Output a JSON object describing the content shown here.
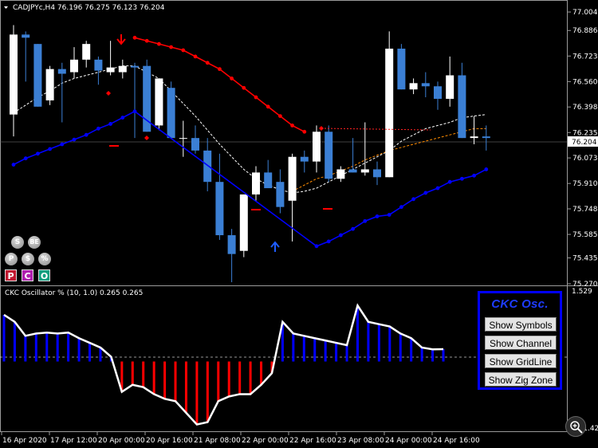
{
  "header": {
    "symbol_line": "CADJPYc,H4  76.196 76.275 76.123 76.204",
    "indicator_line": "CKC Oscillator % (10, 1.0) 0.265 0.265"
  },
  "current_price": "76.204",
  "sub_axis_top": "1.529",
  "sub_axis_bottom": "-1.427",
  "panel": {
    "title": "CKC Osc.",
    "buttons": [
      "Show Symbols",
      "Show Channel",
      "Show GridLine",
      "Show Zig Zone"
    ]
  },
  "toolbar": {
    "round_buttons": [
      "S",
      "BE",
      "P",
      "$",
      "%"
    ],
    "square_buttons": [
      "P",
      "C",
      "O"
    ]
  },
  "colors": {
    "background": "#000000",
    "bull_candle": "#ffffff",
    "bear_candle": "#3b7fd4",
    "upper_band": "#ff0000",
    "lower_band": "#0000ff",
    "mid_line": "#ffffff",
    "orange_line": "#ff8c00",
    "osc_positive": "#0000ff",
    "osc_negative": "#ff0000",
    "osc_line": "#ffffff"
  },
  "chart_data": [
    {
      "type": "candlestick",
      "title": "CADJPYc,H4",
      "y_ticks": [
        "77.004",
        "76.886",
        "76.723",
        "76.560",
        "76.398",
        "76.235",
        "76.073",
        "75.910",
        "75.748",
        "75.585",
        "75.435",
        "75.270"
      ],
      "ylim": [
        75.27,
        77.05
      ],
      "x_ticks": [
        "16 Apr 2020",
        "17 Apr 12:00",
        "20 Apr 00:00",
        "20 Apr 16:00",
        "21 Apr 08:00",
        "22 Apr 00:00",
        "22 Apr 16:00",
        "23 Apr 08:00",
        "24 Apr 00:00",
        "24 Apr 16:00"
      ],
      "candles": [
        {
          "o": 76.35,
          "h": 76.92,
          "l": 76.21,
          "c": 76.86
        },
        {
          "o": 76.86,
          "h": 76.88,
          "l": 76.56,
          "c": 76.84
        },
        {
          "o": 76.8,
          "h": 76.8,
          "l": 76.4,
          "c": 76.4
        },
        {
          "o": 76.44,
          "h": 76.66,
          "l": 76.41,
          "c": 76.64
        },
        {
          "o": 76.64,
          "h": 76.68,
          "l": 76.3,
          "c": 76.61
        },
        {
          "o": 76.62,
          "h": 76.78,
          "l": 76.58,
          "c": 76.7
        },
        {
          "o": 76.7,
          "h": 76.82,
          "l": 76.65,
          "c": 76.8
        },
        {
          "o": 76.7,
          "h": 76.72,
          "l": 76.54,
          "c": 76.63
        },
        {
          "o": 76.62,
          "h": 76.82,
          "l": 76.6,
          "c": 76.65
        },
        {
          "o": 76.62,
          "h": 76.7,
          "l": 76.58,
          "c": 76.66
        },
        {
          "o": 76.66,
          "h": 76.68,
          "l": 76.2,
          "c": 76.65
        },
        {
          "o": 76.66,
          "h": 76.7,
          "l": 76.24,
          "c": 76.24
        },
        {
          "o": 76.28,
          "h": 76.58,
          "l": 76.25,
          "c": 76.58
        },
        {
          "o": 76.52,
          "h": 76.56,
          "l": 76.2,
          "c": 76.2
        },
        {
          "o": 76.2,
          "h": 76.31,
          "l": 76.08,
          "c": 76.2
        },
        {
          "o": 76.2,
          "h": 76.28,
          "l": 76.1,
          "c": 76.12
        },
        {
          "o": 76.12,
          "h": 76.2,
          "l": 75.86,
          "c": 75.92
        },
        {
          "o": 75.92,
          "h": 76.1,
          "l": 75.55,
          "c": 75.58
        },
        {
          "o": 75.58,
          "h": 75.62,
          "l": 75.28,
          "c": 75.46
        },
        {
          "o": 75.48,
          "h": 75.84,
          "l": 75.44,
          "c": 75.84
        },
        {
          "o": 75.84,
          "h": 76.02,
          "l": 75.8,
          "c": 75.98
        },
        {
          "o": 75.98,
          "h": 76.06,
          "l": 75.9,
          "c": 75.88
        },
        {
          "o": 75.92,
          "h": 76.0,
          "l": 75.72,
          "c": 75.76
        },
        {
          "o": 75.8,
          "h": 76.1,
          "l": 75.54,
          "c": 76.08
        },
        {
          "o": 76.08,
          "h": 76.12,
          "l": 75.98,
          "c": 76.05
        },
        {
          "o": 76.05,
          "h": 76.28,
          "l": 75.98,
          "c": 76.24
        },
        {
          "o": 76.24,
          "h": 76.28,
          "l": 75.92,
          "c": 75.94
        },
        {
          "o": 75.94,
          "h": 76.02,
          "l": 75.92,
          "c": 76.0
        },
        {
          "o": 76.0,
          "h": 76.2,
          "l": 75.98,
          "c": 75.98
        },
        {
          "o": 75.98,
          "h": 76.3,
          "l": 75.96,
          "c": 76.0
        },
        {
          "o": 76.0,
          "h": 76.05,
          "l": 75.9,
          "c": 75.95
        },
        {
          "o": 75.95,
          "h": 76.88,
          "l": 75.95,
          "c": 76.77
        },
        {
          "o": 76.77,
          "h": 76.8,
          "l": 76.51,
          "c": 76.51
        },
        {
          "o": 76.51,
          "h": 76.58,
          "l": 76.48,
          "c": 76.55
        },
        {
          "o": 76.55,
          "h": 76.62,
          "l": 76.46,
          "c": 76.53
        },
        {
          "o": 76.53,
          "h": 76.56,
          "l": 76.38,
          "c": 76.45
        },
        {
          "o": 76.45,
          "h": 76.72,
          "l": 76.4,
          "c": 76.6
        },
        {
          "o": 76.6,
          "h": 76.68,
          "l": 76.2,
          "c": 76.2
        },
        {
          "o": 76.2,
          "h": 76.34,
          "l": 76.16,
          "c": 76.21
        },
        {
          "o": 76.21,
          "h": 76.28,
          "l": 76.12,
          "c": 76.2
        }
      ],
      "upper_band": [
        null,
        null,
        null,
        null,
        null,
        null,
        null,
        null,
        null,
        null,
        76.84,
        76.82,
        76.8,
        76.78,
        76.76,
        76.72,
        76.68,
        76.64,
        76.58,
        76.52,
        76.46,
        76.4,
        76.34,
        76.28,
        76.24,
        null,
        null,
        null,
        null,
        null,
        null,
        null,
        null,
        null,
        null,
        null,
        null,
        null,
        null,
        null
      ],
      "lower_band": [
        76.03,
        76.07,
        76.1,
        76.13,
        76.16,
        76.19,
        76.22,
        76.26,
        76.29,
        76.33,
        76.37,
        null,
        null,
        null,
        null,
        null,
        null,
        null,
        null,
        null,
        null,
        null,
        null,
        null,
        null,
        75.51,
        75.54,
        75.58,
        75.62,
        75.67,
        75.7,
        75.71,
        75.76,
        75.81,
        75.85,
        75.88,
        75.92,
        75.94,
        75.96,
        76.0
      ],
      "mid_line": [
        76.36,
        76.41,
        76.46,
        76.5,
        76.55,
        76.58,
        76.6,
        76.62,
        76.64,
        76.66,
        76.66,
        76.62,
        76.58,
        76.5,
        76.42,
        76.34,
        76.25,
        76.16,
        76.08,
        76.0,
        75.94,
        75.9,
        75.87,
        75.85,
        75.86,
        75.88,
        75.92,
        75.96,
        76.0,
        76.04,
        76.08,
        76.12,
        76.18,
        76.22,
        76.26,
        76.28,
        76.3,
        76.33,
        76.34,
        76.35
      ],
      "orange_line": [
        null,
        null,
        null,
        null,
        null,
        null,
        null,
        null,
        null,
        null,
        null,
        null,
        null,
        null,
        null,
        null,
        null,
        null,
        null,
        null,
        null,
        null,
        null,
        75.86,
        75.9,
        75.94,
        75.96,
        75.99,
        76.02,
        76.06,
        76.09,
        76.12,
        76.14,
        76.16,
        76.18,
        76.2,
        76.22,
        76.24,
        76.26,
        76.26
      ],
      "y_sep_level": 75.757
    },
    {
      "type": "histogram+line",
      "title": "CKC Oscillator % (10, 1.0)",
      "ylim": [
        -1.427,
        1.529
      ],
      "values": [
        1.0,
        0.85,
        0.55,
        0.6,
        0.62,
        0.6,
        0.62,
        0.5,
        0.4,
        0.3,
        0.1,
        -0.65,
        -0.5,
        -0.55,
        -0.7,
        -0.8,
        -0.85,
        -1.1,
        -1.35,
        -1.3,
        -0.85,
        -0.75,
        -0.7,
        -0.7,
        -0.5,
        -0.25,
        0.85,
        0.6,
        0.55,
        0.5,
        0.45,
        0.4,
        0.35,
        1.2,
        0.85,
        0.8,
        0.75,
        0.6,
        0.5,
        0.3,
        0.26,
        0.265
      ],
      "y_level": 0.265
    }
  ]
}
